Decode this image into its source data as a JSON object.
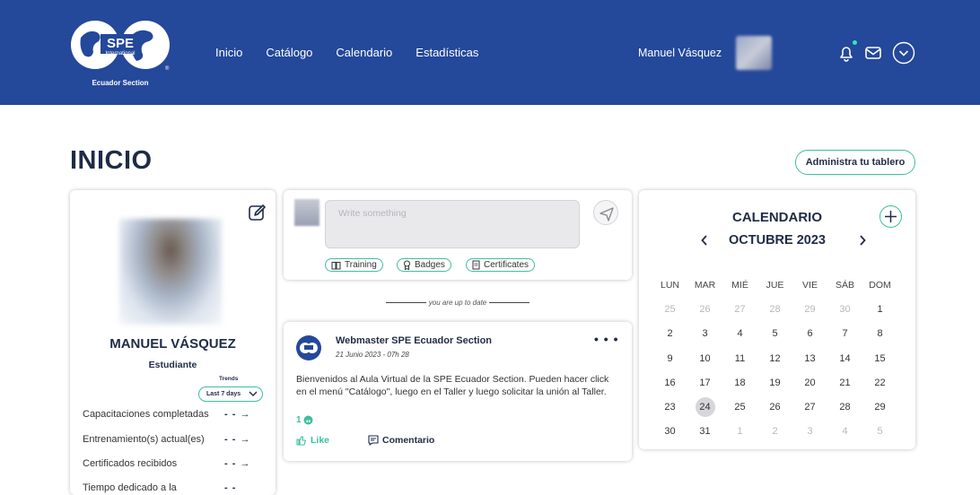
{
  "header": {
    "logo": {
      "brand": "SPE",
      "sub": "International",
      "section": "Ecuador Section"
    },
    "nav": [
      "Inicio",
      "Catálogo",
      "Calendario",
      "Estadísticas"
    ],
    "user_name": "Manuel Vásquez",
    "colors": {
      "bg": "#24489a",
      "accent": "#36e3c3"
    }
  },
  "page": {
    "title": "INICIO",
    "admin_button": "Administra tu tablero"
  },
  "profile": {
    "name": "MANUEL VÁSQUEZ",
    "role": "Estudiante",
    "trends_label": "Trends",
    "trends_value": "Last 7 days",
    "stats": [
      {
        "label": "Capacitaciones completadas",
        "value": "- - →"
      },
      {
        "label": "Entrenamiento(s) actual(es)",
        "value": "- - →"
      },
      {
        "label": "Certificados recibidos",
        "value": "- - →"
      },
      {
        "label": "Tiempo dedicado a la",
        "value": "- -"
      }
    ]
  },
  "composer": {
    "placeholder": "Write something",
    "chips": [
      "Training",
      "Badges",
      "Certificates"
    ]
  },
  "feed": {
    "status": "you are up to date",
    "post": {
      "author": "Webmaster SPE Ecuador Section",
      "date": "21 Junio 2023 - 07h 28",
      "body": "Bienvenidos al Aula Virtual de la SPE Ecuador Section. Pueden hacer click en el menú \"Catálogo\", luego en el Taller y luego solicitar la unión al Taller.",
      "likes": "1",
      "like_label": "Like",
      "comment_label": "Comentario",
      "more": "• • •"
    }
  },
  "calendar": {
    "title": "CALENDARIO",
    "month": "OCTUBRE 2023",
    "weekdays": [
      "LUN",
      "MAR",
      "MIÉ",
      "JUE",
      "VIE",
      "SÁB",
      "DOM"
    ],
    "weeks": [
      [
        "25",
        "26",
        "27",
        "28",
        "29",
        "30",
        "1"
      ],
      [
        "2",
        "3",
        "4",
        "5",
        "6",
        "7",
        "8"
      ],
      [
        "9",
        "10",
        "11",
        "12",
        "13",
        "14",
        "15"
      ],
      [
        "16",
        "17",
        "18",
        "19",
        "20",
        "21",
        "22"
      ],
      [
        "23",
        "24",
        "25",
        "26",
        "27",
        "28",
        "29"
      ],
      [
        "30",
        "31",
        "1",
        "2",
        "3",
        "4",
        "5"
      ]
    ],
    "today": "24"
  }
}
